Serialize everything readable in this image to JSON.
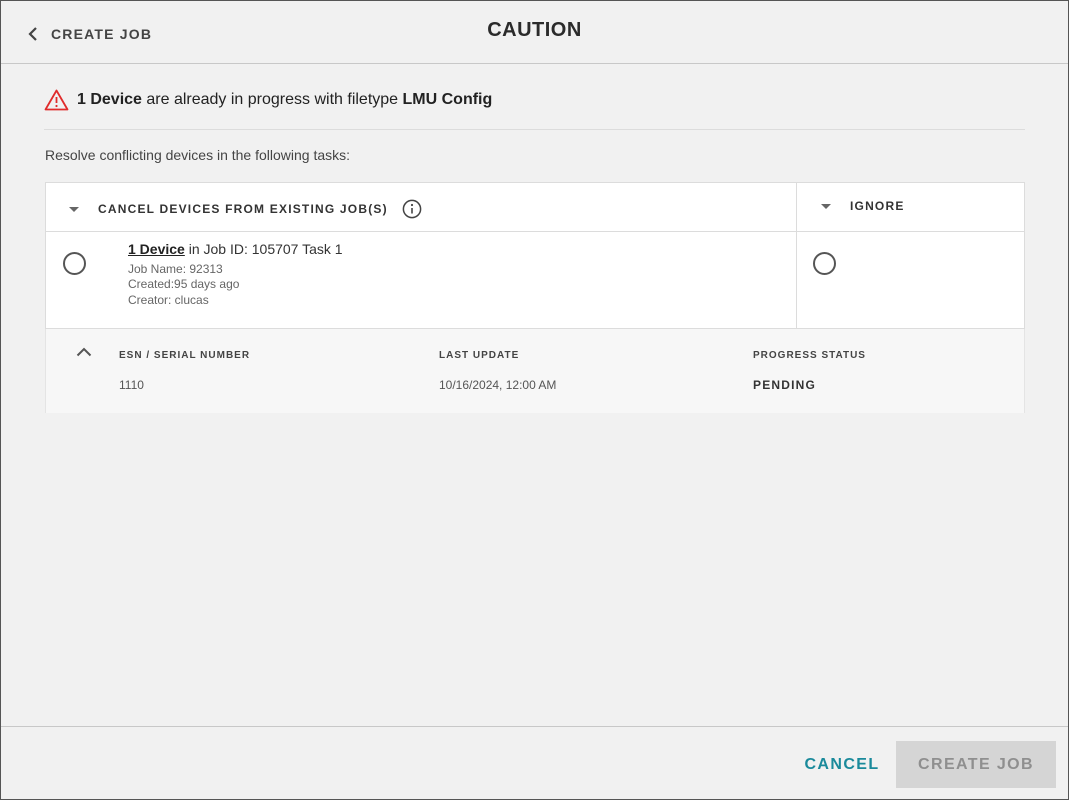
{
  "header": {
    "back_label": "CREATE JOB",
    "title": "CAUTION"
  },
  "warning": {
    "count_text": "1 Device",
    "middle_text": " are already in progress with filetype ",
    "filetype": "LMU Config",
    "icon": "warning-triangle-icon",
    "icon_color": "#e02b2b"
  },
  "resolve_text": "Resolve conflicting devices in the following tasks:",
  "table": {
    "columns": {
      "cancel": "CANCEL DEVICES FROM EXISTING JOB(S)",
      "ignore": "IGNORE"
    },
    "job": {
      "device_link": "1 Device",
      "job_text": " in Job ID: 105707 Task 1",
      "job_name": "Job Name: 92313",
      "created": "Created:95 days ago",
      "creator": "Creator: clucas"
    }
  },
  "detail": {
    "headers": [
      "ESN / SERIAL NUMBER",
      "LAST UPDATE",
      "PROGRESS STATUS"
    ],
    "row": {
      "esn": "1110",
      "last_update": "10/16/2024, 12:00 AM",
      "status": "PENDING"
    }
  },
  "footer": {
    "cancel_label": "CANCEL",
    "create_label": "CREATE JOB",
    "accent": "#1a8a9b"
  }
}
